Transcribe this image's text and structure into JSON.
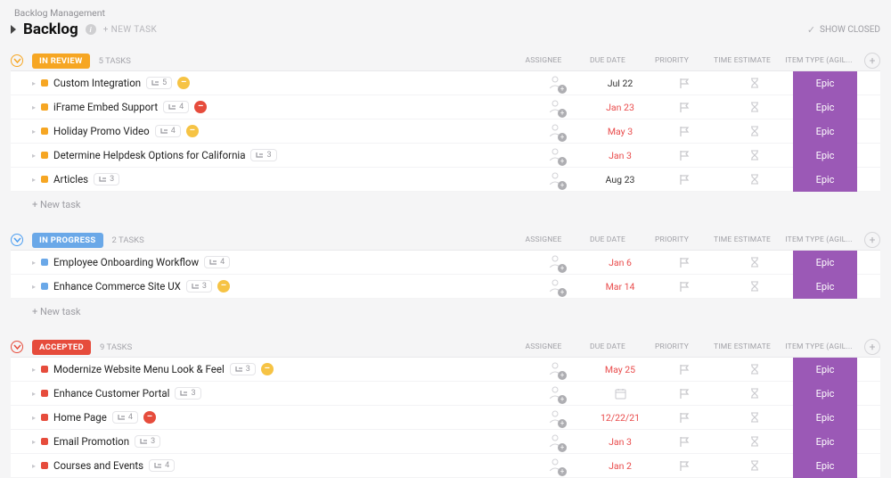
{
  "breadcrumb": "Backlog Management",
  "title": "Backlog",
  "newTaskTop": "+ NEW TASK",
  "showClosed": "SHOW CLOSED",
  "columns": {
    "assignee": "ASSIGNEE",
    "dueDate": "DUE DATE",
    "priority": "PRIORITY",
    "timeEstimate": "TIME ESTIMATE",
    "itemType": "ITEM TYPE (AGIL..."
  },
  "newTaskRow": "+ New task",
  "groups": [
    {
      "status": "IN REVIEW",
      "color": "orange",
      "countLabel": "5 TASKS",
      "showNewTask": true,
      "tasks": [
        {
          "name": "Custom Integration",
          "sub": "5",
          "badge": "yellow",
          "due": "Jul 22",
          "overdue": false,
          "type": "Epic"
        },
        {
          "name": "iFrame Embed Support",
          "sub": "4",
          "badge": "red",
          "due": "Jan 23",
          "overdue": true,
          "type": "Epic"
        },
        {
          "name": "Holiday Promo Video",
          "sub": "4",
          "badge": "yellow",
          "due": "May 3",
          "overdue": true,
          "type": "Epic"
        },
        {
          "name": "Determine Helpdesk Options for California",
          "sub": "3",
          "badge": null,
          "due": "Jan 3",
          "overdue": true,
          "type": "Epic"
        },
        {
          "name": "Articles",
          "sub": "3",
          "badge": null,
          "due": "Aug 23",
          "overdue": false,
          "type": "Epic"
        }
      ]
    },
    {
      "status": "IN PROGRESS",
      "color": "blue",
      "countLabel": "2 TASKS",
      "showNewTask": true,
      "tasks": [
        {
          "name": "Employee Onboarding Workflow",
          "sub": "4",
          "badge": null,
          "due": "Jan 6",
          "overdue": true,
          "type": "Epic"
        },
        {
          "name": "Enhance Commerce Site UX",
          "sub": "3",
          "badge": "yellow",
          "due": "Mar 14",
          "overdue": true,
          "type": "Epic"
        }
      ]
    },
    {
      "status": "ACCEPTED",
      "color": "red",
      "countLabel": "9 TASKS",
      "showNewTask": false,
      "tasks": [
        {
          "name": "Modernize Website Menu Look & Feel",
          "sub": "3",
          "badge": "yellow",
          "due": "May 25",
          "overdue": true,
          "type": "Epic"
        },
        {
          "name": "Enhance Customer Portal",
          "sub": "3",
          "badge": null,
          "due": "__CAL__",
          "overdue": false,
          "type": "Epic"
        },
        {
          "name": "Home Page",
          "sub": "4",
          "badge": "red",
          "due": "12/22/21",
          "overdue": true,
          "type": "Epic"
        },
        {
          "name": "Email Promotion",
          "sub": "3",
          "badge": null,
          "due": "Jan 3",
          "overdue": true,
          "type": "Epic"
        },
        {
          "name": "Courses and Events",
          "sub": "4",
          "badge": null,
          "due": "Jan 2",
          "overdue": true,
          "type": "Epic"
        }
      ]
    }
  ]
}
